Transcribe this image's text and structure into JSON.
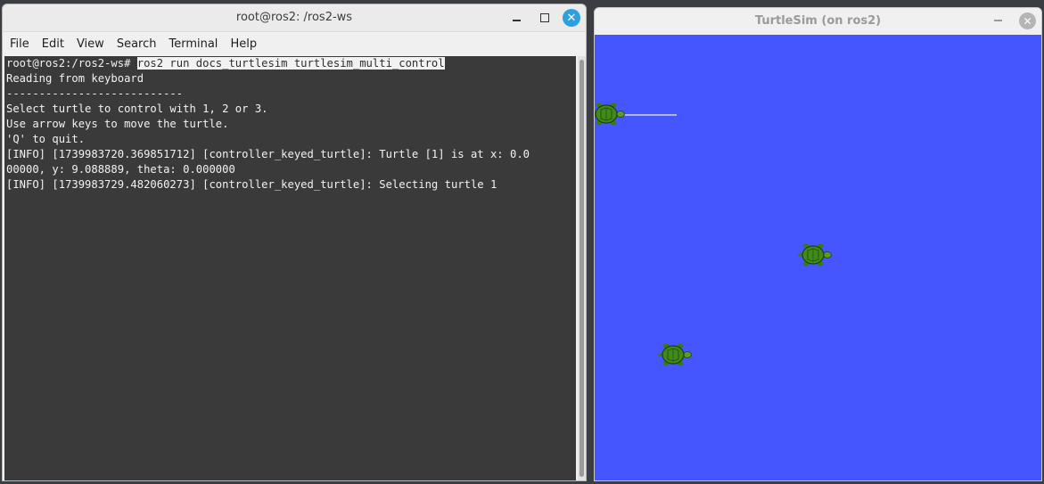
{
  "terminal": {
    "title": "root@ros2: /ros2-ws",
    "menu": [
      "File",
      "Edit",
      "View",
      "Search",
      "Terminal",
      "Help"
    ],
    "prompt": "root@ros2:/ros2-ws# ",
    "command": "ros2 run docs_turtlesim turtlesim_multi_control",
    "output": [
      "Reading from keyboard",
      "---------------------------",
      "Select turtle to control with 1, 2 or 3.",
      "Use arrow keys to move the turtle.",
      "'Q' to quit.",
      "[INFO] [1739983720.369851712] [controller_keyed_turtle]: Turtle [1] is at x: 0.0",
      "00000, y: 9.088889, theta: 0.000000",
      "[INFO] [1739983729.482060273] [controller_keyed_turtle]: Selecting turtle 1"
    ],
    "buttons": {
      "minimize": "minimize-icon",
      "maximize": "maximize-icon",
      "close": "close-icon"
    }
  },
  "turtlesim": {
    "title": "TurtleSim (on ros2)",
    "background_color": "#4556ff",
    "turtle_count": 3
  },
  "colors": {
    "terminal_bg": "#3a3a3a",
    "terminal_fg": "#f2f2f2",
    "close_accent": "#2ea0e0"
  }
}
